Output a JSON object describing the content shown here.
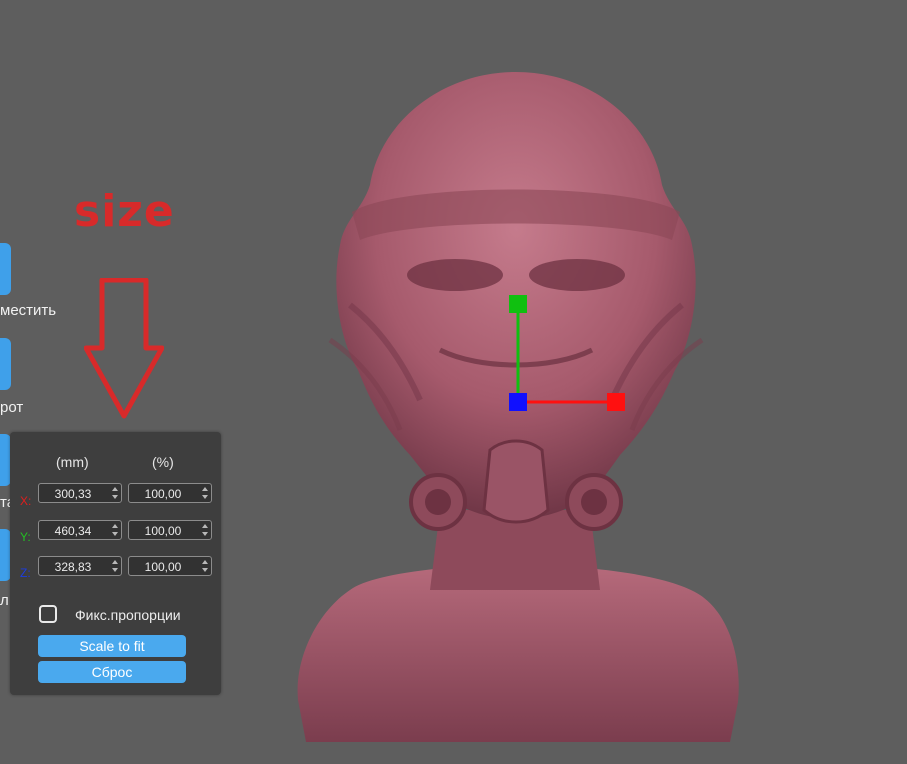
{
  "annotation": {
    "text": "size"
  },
  "toolbar": {
    "items": [
      {
        "label": "местить"
      },
      {
        "label": "рот"
      },
      {
        "label": "та"
      },
      {
        "label": "л"
      }
    ]
  },
  "scale_panel": {
    "headers": {
      "mm": "(mm)",
      "percent": "(%)"
    },
    "rows": [
      {
        "axis": "X:",
        "mm": "300,33",
        "percent": "100,00",
        "color": "#e01e1e"
      },
      {
        "axis": "Y:",
        "mm": "460,34",
        "percent": "100,00",
        "color": "#22c022"
      },
      {
        "axis": "Z:",
        "mm": "328,83",
        "percent": "100,00",
        "color": "#1c3ce0"
      }
    ],
    "lock_proportions": {
      "label": "Фикс.пропорции",
      "checked": false
    },
    "scale_to_fit_label": "Scale to fit",
    "reset_label": "Сброс"
  },
  "colors": {
    "background": "#5e5e5e",
    "panel": "#3e3e3e",
    "accent": "#4aa9ee",
    "model": "#a65a6c",
    "gizmo_x": "#ff1010",
    "gizmo_y": "#10c010",
    "gizmo_z": "#1010ff"
  }
}
